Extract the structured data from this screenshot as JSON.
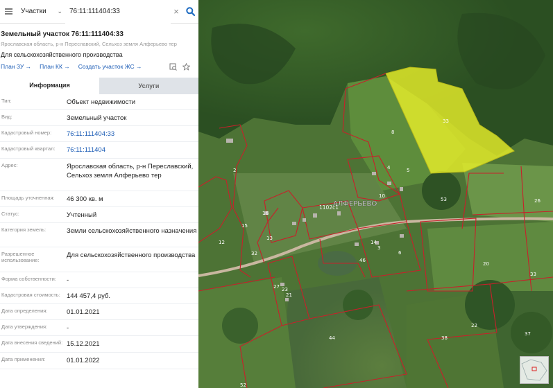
{
  "search": {
    "layer": "Участки",
    "query": "76:11:111404:33"
  },
  "object": {
    "title": "Земельный участок 76:11:111404:33",
    "address": "Ярославская область, р-н Переславский, Сельхоз земля Алферьево тер",
    "purpose": "Для сельскохозяйственного производства"
  },
  "links": {
    "plan_zu": "План ЗУ →",
    "plan_kk": "План КК →",
    "create_zs": "Создать участок ЖС →"
  },
  "tabs": {
    "info": "Информация",
    "services": "Услуги"
  },
  "props": [
    {
      "k": "Тип:",
      "v": "Объект недвижимости"
    },
    {
      "k": "Вид:",
      "v": "Земельный участок"
    },
    {
      "k": "Кадастровый номер:",
      "v": "76:11:111404:33"
    },
    {
      "k": "Кадастровый квартал:",
      "v": "76:11:111404"
    },
    {
      "k": "Адрес:",
      "v": "Ярославская область, р-н Переславский, Сельхоз земля Алферьево тер"
    },
    {
      "k": "Площадь уточненная:",
      "v": "46 300 кв. м"
    },
    {
      "k": "Статус:",
      "v": "Учтенный"
    },
    {
      "k": "Категория земель:",
      "v": "Земли сельскохозяйственного назначения"
    },
    {
      "k": "Разрешенное использование:",
      "v": "Для сельскохозяйственного производства"
    },
    {
      "k": "Форма собственности:",
      "v": "-"
    },
    {
      "k": "Кадастровая стоимость:",
      "v": "144 457,4 руб."
    },
    {
      "k": "Дата определения:",
      "v": "01.01.2021"
    },
    {
      "k": "Дата утверждения:",
      "v": "-"
    },
    {
      "k": "Дата внесения сведений:",
      "v": "15.12.2021"
    },
    {
      "k": "Дата применения:",
      "v": "01.01.2022"
    }
  ],
  "map": {
    "village_label": "АЛФЕРЬЕВО",
    "village_code": "1102с1",
    "parcel_numbers": [
      "33",
      "8",
      "2",
      "4",
      "53",
      "26",
      "12",
      "20",
      "33",
      "22",
      "38",
      "44",
      "37",
      "16",
      "46",
      "3",
      "14",
      "6",
      "10",
      "32",
      "23",
      "36",
      "15",
      "13",
      "21",
      "27",
      "52",
      "5"
    ]
  },
  "colors": {
    "accent": "#1e6bc1",
    "link": "#1a5bb5",
    "selected_parcel": "#e6ee2a",
    "boundary": "#c8202a"
  }
}
